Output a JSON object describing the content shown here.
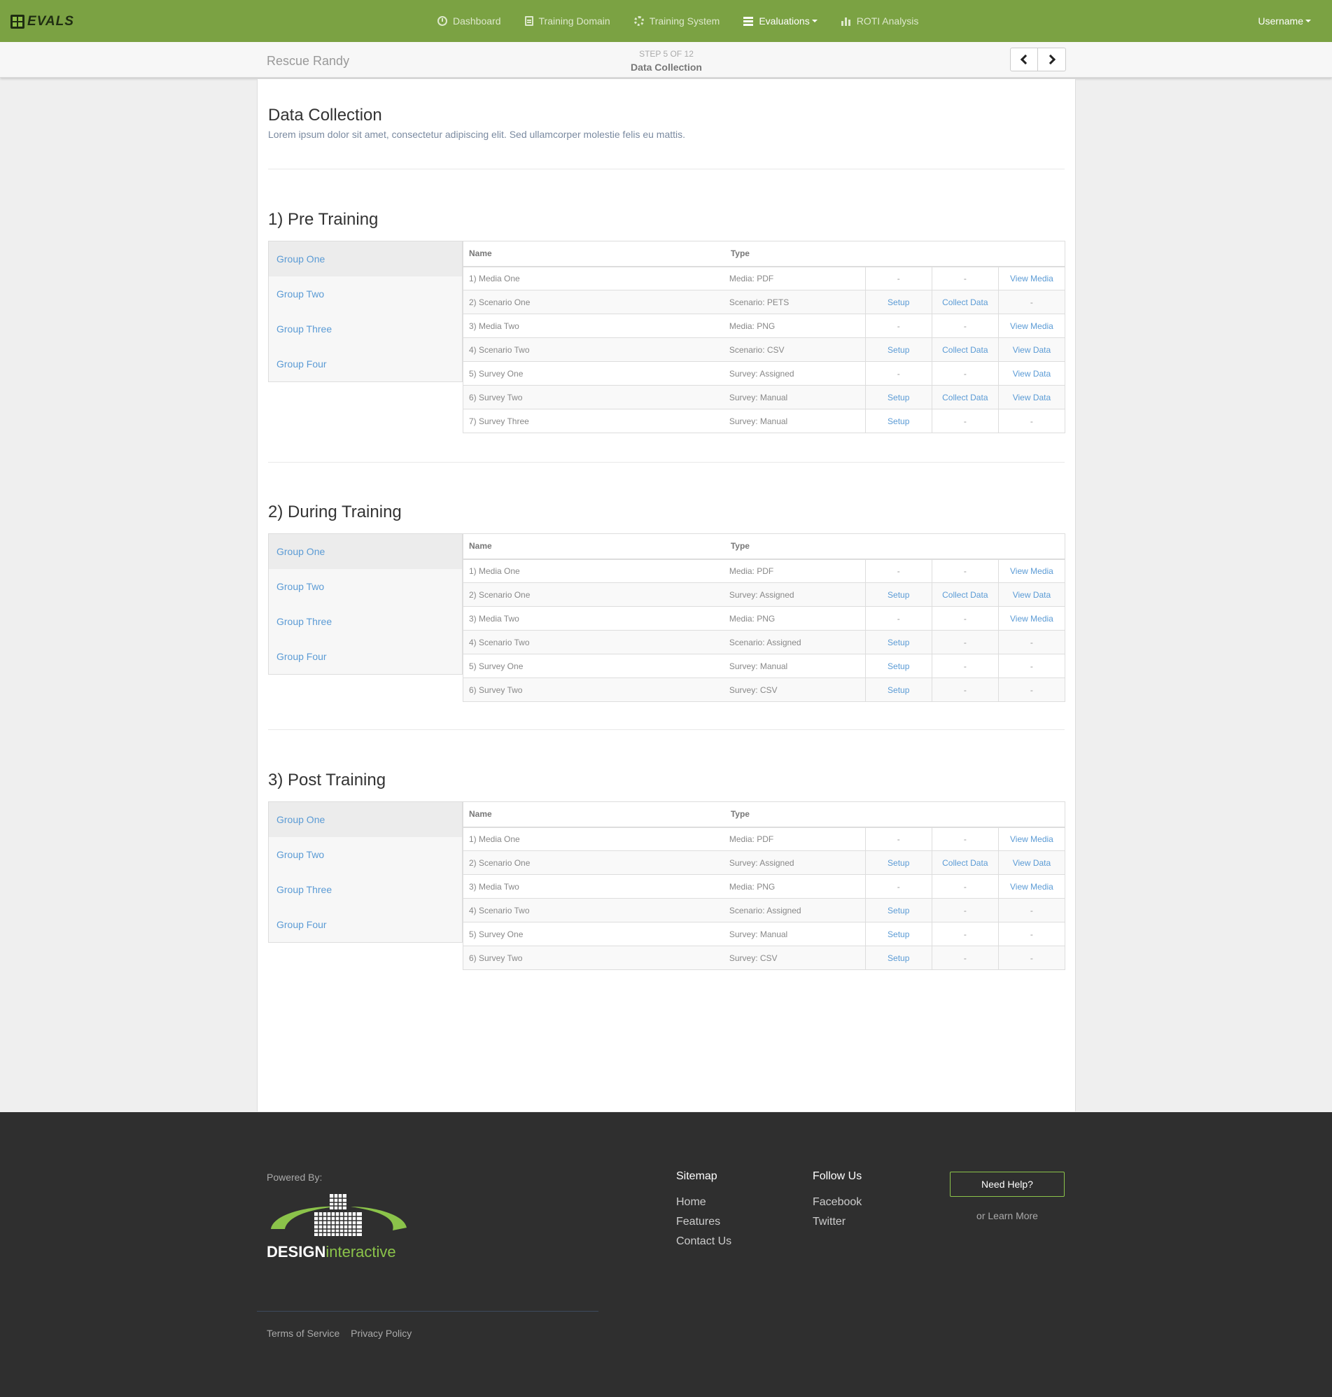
{
  "nav": {
    "logo": "EVALS",
    "items": [
      {
        "label": "Dashboard",
        "icon": "dashboard-icon"
      },
      {
        "label": "Training Domain",
        "icon": "document-icon"
      },
      {
        "label": "Training System",
        "icon": "gear-icon"
      },
      {
        "label": "Evaluations",
        "icon": "list-icon"
      },
      {
        "label": "ROTI Analysis",
        "icon": "bar-chart-icon"
      }
    ],
    "username": "Username"
  },
  "subbar": {
    "project": "Rescue Randy",
    "step": "STEP 5 OF 12",
    "step_title": "Data Collection"
  },
  "page": {
    "title": "Data Collection",
    "subtitle": "Lorem ipsum dolor sit amet, consectetur adipiscing elit. Sed ullamcorper molestie felis eu mattis."
  },
  "sections": [
    {
      "title": "1) Pre Training",
      "groups": [
        "Group One",
        "Group Two",
        "Group Three",
        "Group Four"
      ],
      "headers": [
        "Name",
        "Type"
      ],
      "rows": [
        [
          "1) Media One",
          "Media: PDF",
          "-",
          "-",
          "View Media"
        ],
        [
          "2) Scenario One",
          "Scenario: PETS",
          "Setup",
          "Collect Data",
          "-"
        ],
        [
          "3) Media Two",
          "Media: PNG",
          "-",
          "-",
          "View Media"
        ],
        [
          "4) Scenario Two",
          "Scenario: CSV",
          "Setup",
          "Collect Data",
          "View Data"
        ],
        [
          "5) Survey One",
          "Survey: Assigned",
          "-",
          "-",
          "View Data"
        ],
        [
          "6) Survey Two",
          "Survey: Manual",
          "Setup",
          "Collect Data",
          "View Data"
        ],
        [
          "7) Survey Three",
          "Survey: Manual",
          "Setup",
          "-",
          "-"
        ]
      ]
    },
    {
      "title": "2) During Training",
      "groups": [
        "Group One",
        "Group Two",
        "Group Three",
        "Group Four"
      ],
      "headers": [
        "Name",
        "Type"
      ],
      "rows": [
        [
          "1) Media One",
          "Media: PDF",
          "-",
          "-",
          "View Media"
        ],
        [
          "2) Scenario One",
          "Survey: Assigned",
          "Setup",
          "Collect Data",
          "View Data"
        ],
        [
          "3) Media Two",
          "Media: PNG",
          "-",
          "-",
          "View Media"
        ],
        [
          "4) Scenario Two",
          "Scenario: Assigned",
          "Setup",
          "-",
          "-"
        ],
        [
          "5) Survey One",
          "Survey: Manual",
          "Setup",
          "-",
          "-"
        ],
        [
          "6) Survey Two",
          "Survey: CSV",
          "Setup",
          "-",
          "-"
        ]
      ]
    },
    {
      "title": "3) Post Training",
      "groups": [
        "Group One",
        "Group Two",
        "Group Three",
        "Group Four"
      ],
      "headers": [
        "Name",
        "Type"
      ],
      "rows": [
        [
          "1) Media One",
          "Media: PDF",
          "-",
          "-",
          "View Media"
        ],
        [
          "2) Scenario One",
          "Survey: Assigned",
          "Setup",
          "Collect Data",
          "View Data"
        ],
        [
          "3) Media Two",
          "Media: PNG",
          "-",
          "-",
          "View Media"
        ],
        [
          "4) Scenario Two",
          "Scenario: Assigned",
          "Setup",
          "-",
          "-"
        ],
        [
          "5) Survey One",
          "Survey: Manual",
          "Setup",
          "-",
          "-"
        ],
        [
          "6) Survey Two",
          "Survey: CSV",
          "Setup",
          "-",
          "-"
        ]
      ]
    }
  ],
  "footer": {
    "powered_by": "Powered By:",
    "logo_text_a": "DESIGN",
    "logo_text_b": "interactive",
    "sitemap_title": "Sitemap",
    "sitemap": [
      "Home",
      "Features",
      "Contact Us"
    ],
    "follow_title": "Follow Us",
    "follow": [
      "Facebook",
      "Twitter"
    ],
    "help_button": "Need Help?",
    "learn_more": "or Learn More",
    "terms": "Terms of Service",
    "privacy": "Privacy Policy"
  },
  "colors": {
    "nav_green": "#7ba243",
    "link_blue": "#5b9bd5",
    "footer_bg": "#2f2f2f",
    "logo_accent": "#8bc34a"
  }
}
